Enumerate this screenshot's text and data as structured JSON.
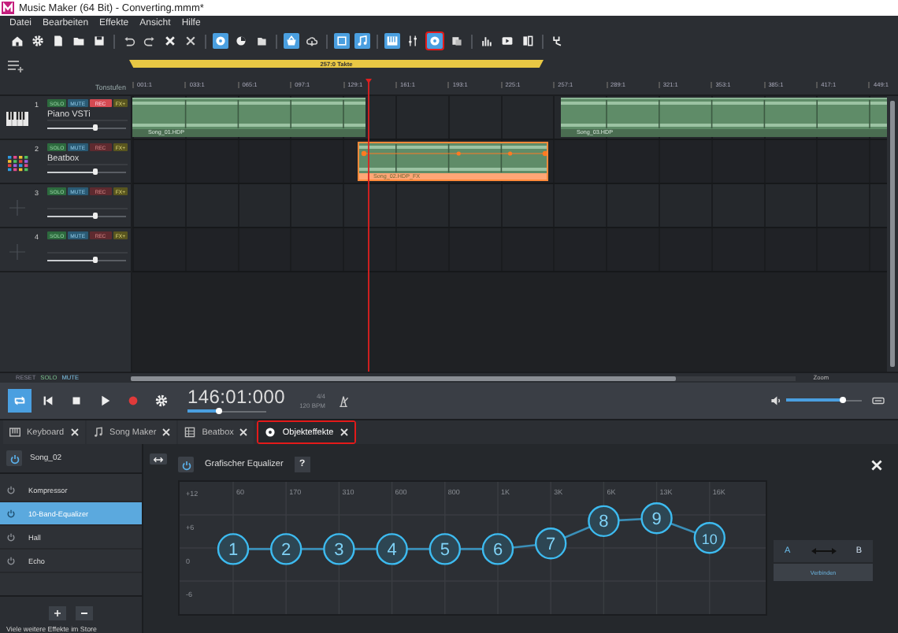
{
  "window": {
    "title": "Music Maker (64 Bit) - Converting.mmm*"
  },
  "menu": [
    "Datei",
    "Bearbeiten",
    "Effekte",
    "Ansicht",
    "Hilfe"
  ],
  "toolbar": [
    {
      "kind": "button",
      "active": false,
      "annotated": false
    },
    {
      "kind": "button",
      "active": false,
      "annotated": false
    },
    {
      "kind": "button",
      "active": false,
      "annotated": false
    },
    {
      "kind": "button",
      "active": false,
      "annotated": false
    },
    {
      "kind": "button",
      "active": false,
      "annotated": false
    },
    {
      "kind": "separator"
    },
    {
      "kind": "button",
      "active": false,
      "annotated": false
    },
    {
      "kind": "button",
      "active": false,
      "annotated": false
    },
    {
      "kind": "button",
      "active": false,
      "annotated": false
    },
    {
      "kind": "button",
      "active": false,
      "annotated": false
    },
    {
      "kind": "separator"
    },
    {
      "kind": "button",
      "active": true,
      "annotated": false
    },
    {
      "kind": "button",
      "active": false,
      "annotated": false
    },
    {
      "kind": "button",
      "active": false,
      "annotated": false
    },
    {
      "kind": "separator"
    },
    {
      "kind": "button",
      "active": true,
      "annotated": false
    },
    {
      "kind": "button",
      "active": false,
      "annotated": false
    },
    {
      "kind": "separator"
    },
    {
      "kind": "button",
      "active": true,
      "annotated": false
    },
    {
      "kind": "button",
      "active": true,
      "annotated": false
    },
    {
      "kind": "separator"
    },
    {
      "kind": "button",
      "active": true,
      "annotated": false
    },
    {
      "kind": "button",
      "active": false,
      "annotated": false
    },
    {
      "kind": "button",
      "active": true,
      "annotated": true
    },
    {
      "kind": "button",
      "active": false,
      "annotated": false
    },
    {
      "kind": "separator"
    },
    {
      "kind": "button",
      "active": false,
      "annotated": false
    },
    {
      "kind": "button",
      "active": false,
      "annotated": false
    },
    {
      "kind": "button",
      "active": false,
      "annotated": false
    },
    {
      "kind": "separator"
    },
    {
      "kind": "button",
      "active": false,
      "annotated": false
    }
  ],
  "arranger": {
    "range_label": "257:0 Takte",
    "ruler_caption": "Tonstufen",
    "ruler": [
      "001:1",
      "033:1",
      "065:1",
      "097:1",
      "129:1",
      "161:1",
      "193:1",
      "225:1",
      "257:1",
      "289:1",
      "321:1",
      "353:1",
      "385:1",
      "417:1",
      "449:1"
    ],
    "tracks": [
      {
        "number": "1",
        "name": "Piano VSTi",
        "kind": "piano",
        "solo": "SOLO",
        "mute": "MUTE",
        "rec": "REC",
        "rec_armed": true,
        "fx": "FX+",
        "level": 0.6,
        "clips": [
          {
            "name": "Song_01.HDP",
            "selected": false
          },
          {
            "name": "Song_03.HDP",
            "selected": false
          }
        ]
      },
      {
        "number": "2",
        "name": "Beatbox",
        "kind": "drums",
        "solo": "SOLO",
        "mute": "MUTE",
        "rec": "REC",
        "rec_armed": false,
        "fx": "FX+",
        "level": 0.6,
        "clips": [
          {
            "name": "Song_02.HDP_FX",
            "selected": true
          }
        ]
      },
      {
        "number": "3",
        "kind": "empty",
        "solo": "SOLO",
        "mute": "MUTE",
        "rec": "REC",
        "rec_armed": false,
        "fx": "FX+",
        "level": 0.6
      },
      {
        "number": "4",
        "kind": "empty",
        "solo": "SOLO",
        "mute": "MUTE",
        "rec": "REC",
        "rec_armed": false,
        "fx": "FX+",
        "level": 0.6
      }
    ],
    "footer": {
      "reset": "RESET",
      "solo": "SOLO",
      "mute": "MUTE",
      "zoom": "Zoom"
    }
  },
  "transport": {
    "loop_on": true,
    "position": "146:01:000",
    "position_slider": {
      "level": 0.4
    },
    "meter": "4/4",
    "tempo": "120 BPM",
    "volume": {
      "level": 0.75
    }
  },
  "tabs": [
    {
      "label": "Keyboard",
      "selected": false,
      "annotated": false
    },
    {
      "label": "Song Maker",
      "selected": false,
      "annotated": false
    },
    {
      "label": "Beatbox",
      "selected": false,
      "annotated": false
    },
    {
      "label": "Objekteffekte",
      "selected": true,
      "annotated": true
    }
  ],
  "effects": {
    "object": "Song_02",
    "items": [
      {
        "label": "Kompressor",
        "selected": false
      },
      {
        "label": "10-Band-Equalizer",
        "selected": true
      },
      {
        "label": "Hall",
        "selected": false
      },
      {
        "label": "Echo",
        "selected": false
      }
    ],
    "store_text": "Viele weitere Effekte im Store"
  },
  "equalizer": {
    "title": "Grafischer Equalizer",
    "help": "?",
    "bands": [
      {
        "label": "1"
      },
      {
        "label": "2"
      },
      {
        "label": "3"
      },
      {
        "label": "4"
      },
      {
        "label": "5"
      },
      {
        "label": "6"
      },
      {
        "label": "7"
      },
      {
        "label": "8"
      },
      {
        "label": "9"
      },
      {
        "label": "10"
      }
    ],
    "chart_data": {
      "type": "line",
      "categories": [
        "60",
        "170",
        "310",
        "600",
        "800",
        "1K",
        "3K",
        "6K",
        "13K",
        "16K"
      ],
      "ylim": [
        -9.6,
        14
      ],
      "yticks": [
        {
          "value": 12,
          "label": "+12"
        },
        {
          "value": 6,
          "label": "+6"
        },
        {
          "value": 0,
          "label": "0"
        },
        {
          "value": -6,
          "label": "-6"
        }
      ],
      "series": [
        {
          "color": "#3a8fb8",
          "marker": "circle",
          "values": [
            2,
            2,
            2,
            2,
            2,
            2,
            3,
            7,
            7.5,
            4
          ]
        }
      ]
    },
    "ab": {
      "a": "A",
      "b": "B",
      "connect": "Verbinden"
    }
  }
}
